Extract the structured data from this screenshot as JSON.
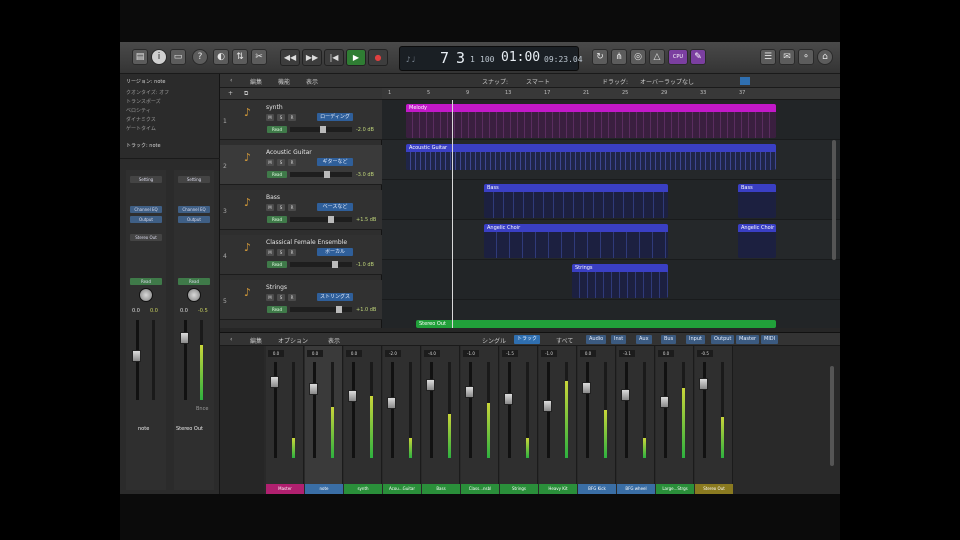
{
  "control_bar": {
    "lcd": {
      "bar": "7",
      "beat": "3",
      "div": "1",
      "tick": "100",
      "time_main": "01:00",
      "time_sub": "09:23.04"
    },
    "cpu_label": "CPU"
  },
  "inspector": {
    "region_label": "リージョン: note",
    "items": [
      "クオンタイズ: オフ",
      "トランスポーズ",
      "ベロシティ",
      "ダイナミクス",
      "ゲートタイム"
    ],
    "track_label": "トラック: note",
    "strip_a": {
      "setting": "Setting",
      "slot1": "Channel EQ",
      "slot2": "Output",
      "send": "Stereo Out",
      "read": "Read",
      "val1": "0.0",
      "val2": "0.0",
      "name": "note"
    },
    "strip_b": {
      "setting": "Setting",
      "slot1": "Channel EQ",
      "slot2": "Output",
      "read": "Read",
      "val1": "0.0",
      "val2": "-0.5",
      "bounce": "Bnce",
      "name": "Stereo Out"
    }
  },
  "track_menu": {
    "edit": "編集",
    "func": "機能",
    "view": "表示",
    "snap": "スナップ:",
    "snap_val": "スマート",
    "drag": "ドラッグ:",
    "drag_val": "オーバーラップなし"
  },
  "tracks": [
    {
      "num": "1",
      "name": "synth",
      "plugin": "ローディング",
      "read": "Read",
      "val": "-2.0 dB"
    },
    {
      "num": "2",
      "name": "Acoustic Guitar",
      "plugin": "ギターなど",
      "read": "Read",
      "val": "-3.0 dB"
    },
    {
      "num": "3",
      "name": "Bass",
      "plugin": "ベースなど",
      "read": "Read",
      "val": "+1.5 dB"
    },
    {
      "num": "4",
      "name": "Classical Female Ensemble",
      "plugin": "ボーカル",
      "read": "Read",
      "val": "-1.0 dB"
    },
    {
      "num": "5",
      "name": "Strings",
      "plugin": "ストリングス",
      "read": "Read",
      "val": "+1.0 dB"
    }
  ],
  "ruler_ticks": [
    "1",
    "5",
    "9",
    "13",
    "17",
    "21",
    "25",
    "29",
    "33",
    "37"
  ],
  "regions": [
    "Melody",
    "Acoustic Guitar",
    "Bass",
    "Bass",
    "Angelic Choir",
    "Angelic Choir",
    "Strings",
    "Stereo Out"
  ],
  "mixer_menu": {
    "edit": "編集",
    "options": "オプション",
    "view": "表示",
    "single": "シングル",
    "tracks": "トラック",
    "all": "すべて"
  },
  "mixer_filters": [
    "Audio",
    "Inst",
    "Aux",
    "Bus",
    "Input",
    "Output",
    "Master",
    "MIDI"
  ],
  "mixer_strips": [
    {
      "name": "Master",
      "val": "0.0",
      "color": "#b0206f"
    },
    {
      "name": "note",
      "val": "0.0",
      "color": "#3a6ea5"
    },
    {
      "name": "synth",
      "val": "0.0",
      "color": "#2a8f3a"
    },
    {
      "name": "Acou...Guitar",
      "val": "-2.0",
      "color": "#2a8f3a"
    },
    {
      "name": "Bass",
      "val": "-4.0",
      "color": "#2a8f3a"
    },
    {
      "name": "Class...nsbl",
      "val": "-1.0",
      "color": "#2a8f3a"
    },
    {
      "name": "Strings",
      "val": "-1.5",
      "color": "#2a8f3a"
    },
    {
      "name": "Heavy Kit",
      "val": "-1.0",
      "color": "#2a8f3a"
    },
    {
      "name": "BFG Kick",
      "val": "0.0",
      "color": "#3a6ea5"
    },
    {
      "name": "BFG wheel",
      "val": "-3.1",
      "color": "#3a6ea5"
    },
    {
      "name": "Large...Strgs",
      "val": "0.0",
      "color": "#2a8f3a"
    },
    {
      "name": "Stereo Out",
      "val": "-0.5",
      "color": "#8a7a20"
    }
  ]
}
